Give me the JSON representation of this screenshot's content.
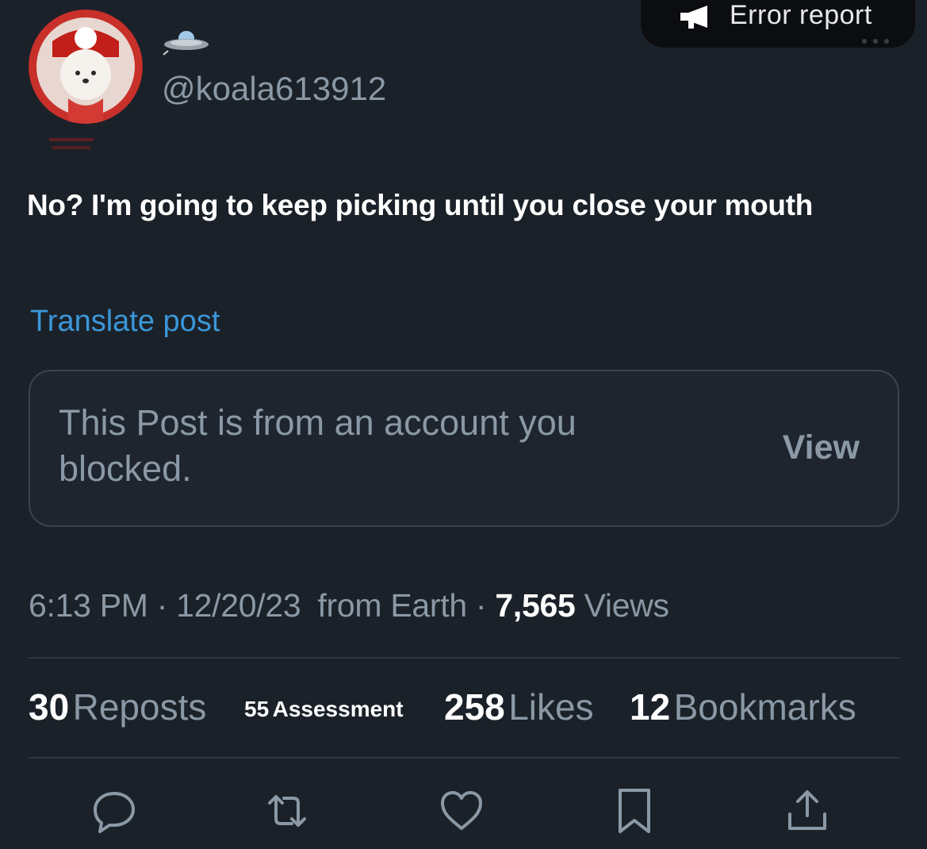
{
  "overlay": {
    "error_report_label": "Error report",
    "icon": "megaphone-icon"
  },
  "post": {
    "handle": "@koala613912",
    "badge_icon": "ufo-icon",
    "text": "No? I'm going to keep picking until you close your mouth",
    "translate_label": "Translate post",
    "blocked_notice": {
      "message": "This Post is from an account you blocked.",
      "view_label": "View"
    },
    "meta": {
      "time": "6:13 PM",
      "date": "12/20/23",
      "source": "from Earth",
      "views_count": "7,565",
      "views_label": "Views"
    },
    "stats": {
      "reposts_count": "30",
      "reposts_label": "Reposts",
      "assessment_count": "55",
      "assessment_label": "Assessment",
      "likes_count": "258",
      "likes_label": "Likes",
      "bookmarks_count": "12",
      "bookmarks_label": "Bookmarks"
    }
  },
  "actions": {
    "icons": [
      "reply-icon",
      "repost-icon",
      "like-icon",
      "bookmark-icon",
      "share-icon"
    ]
  },
  "colors": {
    "background": "#1b2129",
    "link": "#3b97d8",
    "muted": "#8b98a5",
    "text": "#ffffff"
  }
}
